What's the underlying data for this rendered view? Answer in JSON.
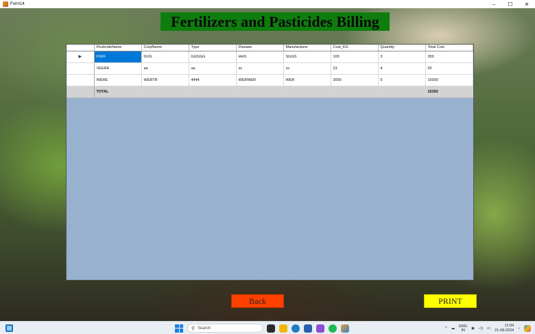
{
  "window": {
    "title": "Form14",
    "minimize": "–",
    "maximize": "☐",
    "close": "✕"
  },
  "form": {
    "heading": "Fertilizers and Pasticides Billing",
    "back_label": "Back",
    "print_label": "PRINT"
  },
  "grid": {
    "columns": [
      "PesticideName",
      "CropName",
      "Type",
      "Disease",
      "Manufacturer",
      "Cost_KG",
      "Quantity",
      "Total Cost"
    ],
    "rows": [
      [
        "FSFF",
        "GVG",
        "GGSGG",
        "HHS",
        "SGGS",
        "100",
        "3",
        "300"
      ],
      [
        "VEERA",
        "aa",
        "aa",
        "ss",
        "ss",
        "23",
        "4",
        "92"
      ],
      [
        "WERE",
        "WERTR",
        "4444",
        "WERWER",
        "WER",
        "3000",
        "5",
        "15000"
      ]
    ],
    "total_label": "TOTAL",
    "total_value": "15392",
    "current_row_marker": "▶"
  },
  "taskbar": {
    "search_placeholder": "Search",
    "language_top": "ENG",
    "language_bottom": "IN",
    "time": "11:04",
    "date": "21-08-2024",
    "apps": [
      "widgets-icon",
      "task-view-icon",
      "file-explorer-icon",
      "edge-icon",
      "store-icon",
      "visual-studio-icon",
      "spotify-icon",
      "form-app-icon"
    ]
  }
}
